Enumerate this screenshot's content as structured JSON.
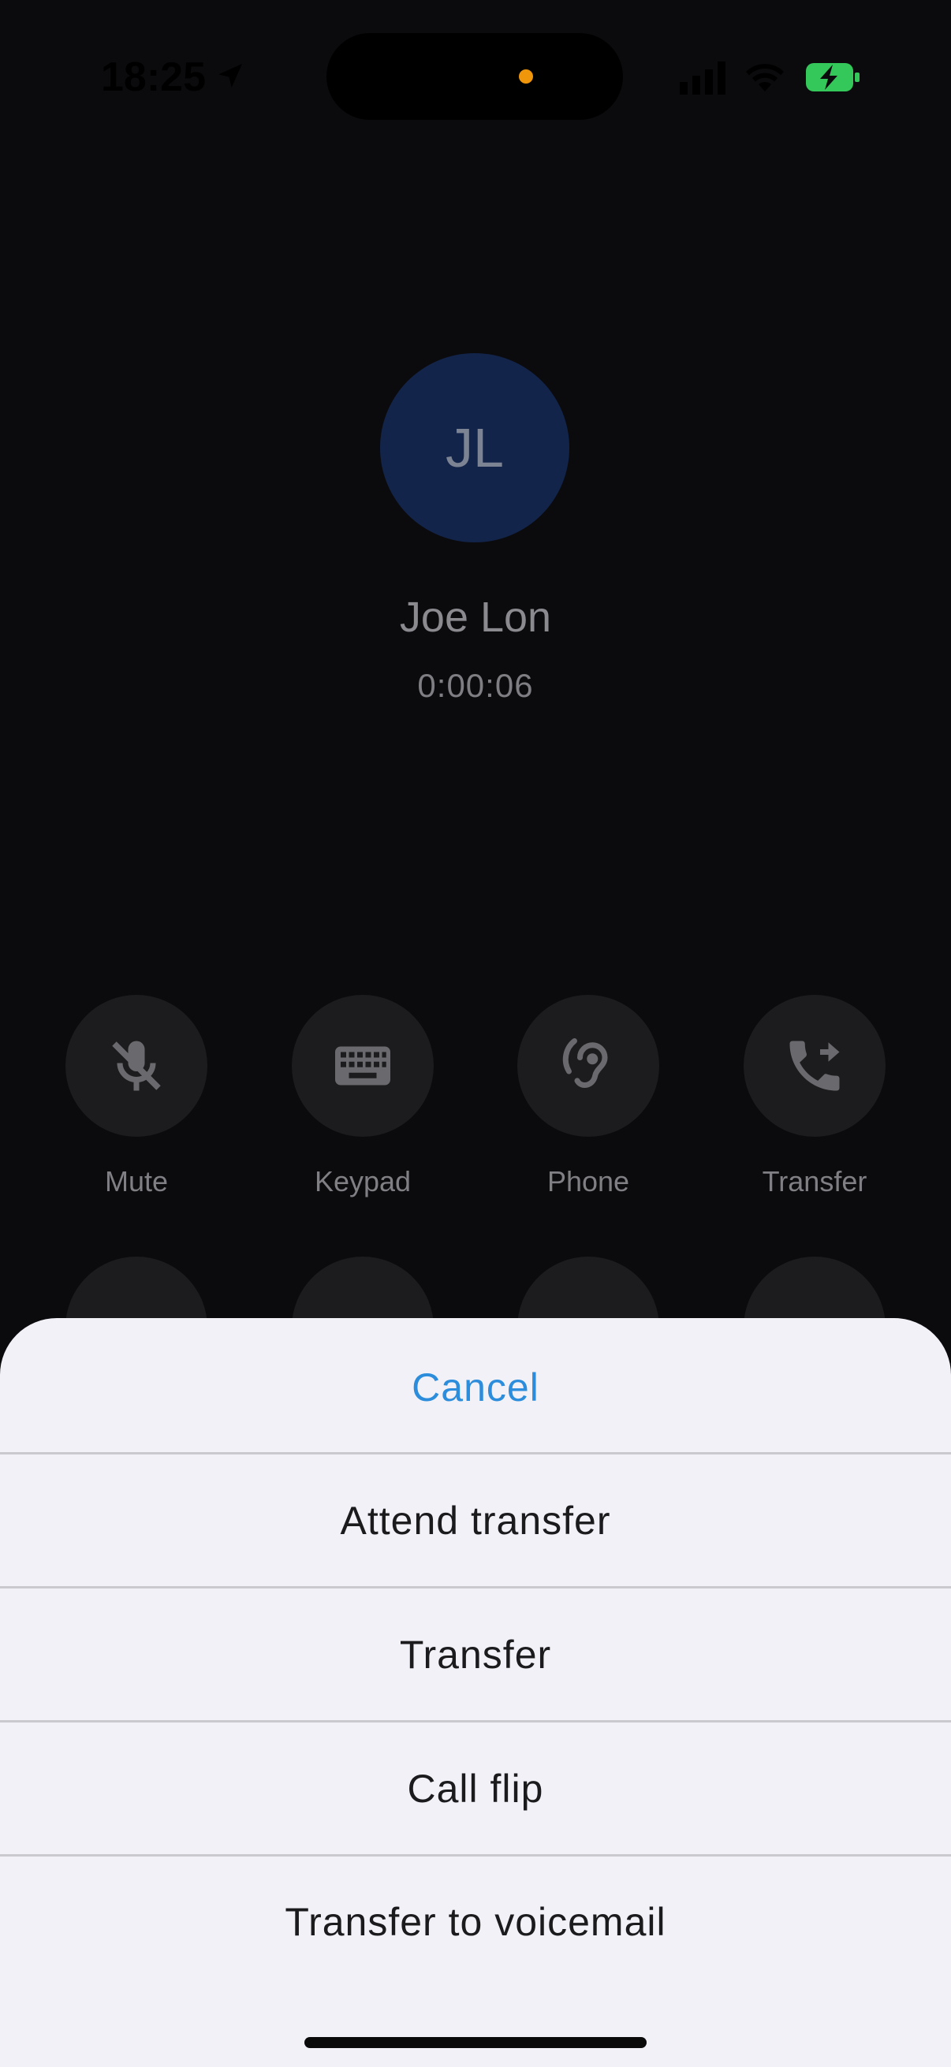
{
  "status_bar": {
    "time": "18:25",
    "icons": [
      "location-arrow-icon",
      "signal-bars-icon",
      "wifi-icon",
      "battery-charging-icon"
    ],
    "battery_color": "#34c759",
    "island_indicator_color": "#f0960a"
  },
  "call": {
    "initials": "JL",
    "name": "Joe Lon",
    "timer": "0:00:06",
    "avatar_color": "#13244a"
  },
  "actions": [
    {
      "label": "Mute",
      "icon": "mic-off-icon"
    },
    {
      "label": "Keypad",
      "icon": "keyboard-icon"
    },
    {
      "label": "Phone",
      "icon": "hearing-icon"
    },
    {
      "label": "Transfer",
      "icon": "phone-forward-icon"
    }
  ],
  "sheet": {
    "cancel": "Cancel",
    "options": [
      "Attend transfer",
      "Transfer",
      "Call flip",
      "Transfer to voicemail"
    ],
    "accent": "#2b8ddb"
  }
}
